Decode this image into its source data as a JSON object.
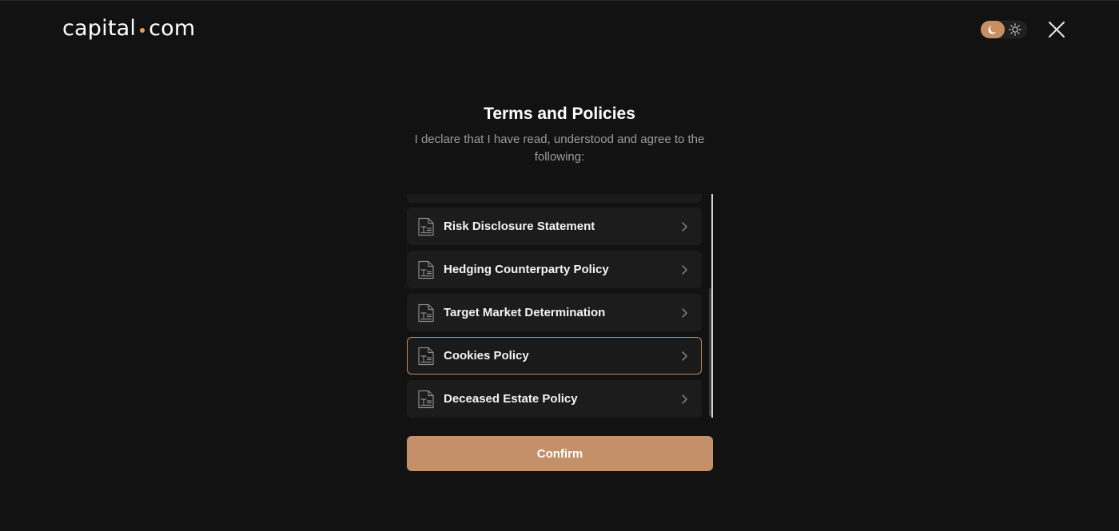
{
  "header": {
    "logo_left": "capital",
    "logo_right": "com",
    "logo_dot_color": "#e8a24b",
    "theme_toggle": {
      "selected": "dark",
      "knob_color": "#c98e62",
      "moon_icon": "moon-icon",
      "sun_icon": "sun-icon"
    },
    "close_icon": "close-icon"
  },
  "main": {
    "title": "Terms and Policies",
    "subtitle": "I declare that I have read, understood and agree to the following:",
    "policies": [
      {
        "label": "Risk Disclosure Statement",
        "icon": "document-icon",
        "active": false
      },
      {
        "label": "Hedging Counterparty Policy",
        "icon": "document-icon",
        "active": false
      },
      {
        "label": "Target Market Determination",
        "icon": "document-icon",
        "active": false
      },
      {
        "label": "Cookies Policy",
        "icon": "document-icon",
        "active": true
      },
      {
        "label": "Deceased Estate Policy",
        "icon": "document-icon",
        "active": false
      }
    ],
    "confirm_label": "Confirm"
  },
  "colors": {
    "background": "#121212",
    "card": "#1c1c1c",
    "accent": "#c28c63",
    "button": "#c3906a",
    "muted_text": "#9a9a9a"
  }
}
